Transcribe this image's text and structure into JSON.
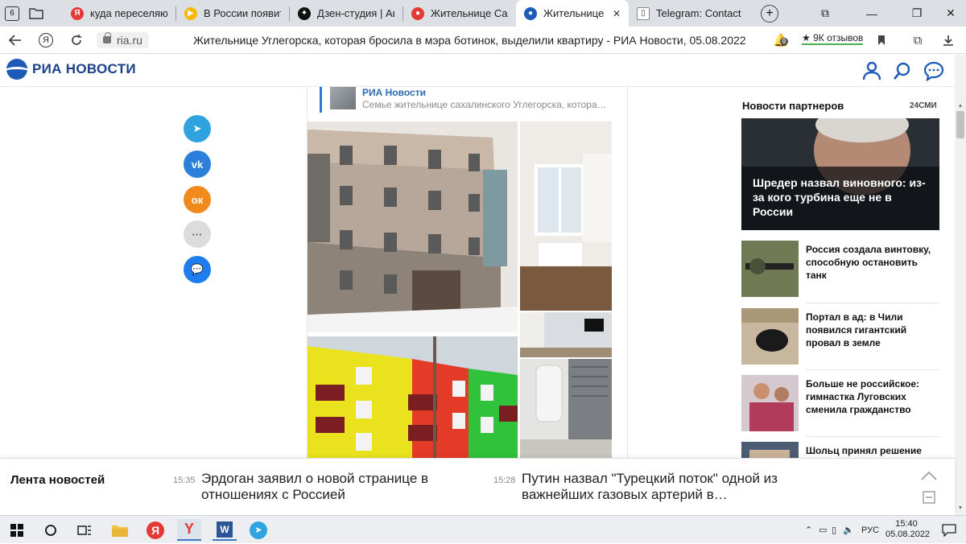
{
  "browser": {
    "tab_counter": "6",
    "tabs": [
      {
        "title": "куда переселяют и",
        "favicon": "yandex-icon",
        "color": "#e53935",
        "glyph": "Я"
      },
      {
        "title": "В России появится",
        "favicon": "play-icon",
        "color": "#f9b700",
        "glyph": "▶"
      },
      {
        "title": "Дзен-студия | Авар",
        "favicon": "zen-icon",
        "color": "#111111",
        "glyph": "✦"
      },
      {
        "title": "Жительнице Сахал",
        "favicon": "ria-icon",
        "color": "#e53935",
        "glyph": "●"
      },
      {
        "title": "Жительнице Угл",
        "favicon": "ria-icon",
        "color": "#1e5bb8",
        "glyph": "●",
        "active": true
      },
      {
        "title": "Telegram: Contact @",
        "favicon": "page-icon",
        "color": "#ffffff",
        "glyph": "▯"
      }
    ],
    "url": "ria.ru",
    "page_title": "Жительнице Углегорска, которая бросила в мэра ботинок, выделили квартиру - РИА Новости, 05.08.2022",
    "reviews_label": "9К отзывов",
    "notif_count": "9"
  },
  "site": {
    "logo_text": "РИА НОВОСТИ",
    "brand_color": "#1e5bb8"
  },
  "share_buttons": [
    {
      "name": "telegram-share-button",
      "color": "#2fa3e0",
      "glyph": "➤"
    },
    {
      "name": "vk-share-button",
      "color": "#2d7fdc",
      "glyph": "vk"
    },
    {
      "name": "ok-share-button",
      "color": "#f08a1c",
      "glyph": "ок"
    },
    {
      "name": "more-share-button",
      "color": "#dcdcdc",
      "glyph": "···"
    },
    {
      "name": "comments-share-button",
      "color": "#1e7ef0",
      "glyph": "💬"
    }
  ],
  "embed": {
    "source": "РИА Новости",
    "text": "Семье жительнице сахалинского Углегорска, котора…"
  },
  "partners": {
    "heading": "Новости партнеров",
    "brand": "24СМИ",
    "featured": "Шредер назвал виновного: из-за кого турбина еще не в России",
    "items": [
      "Россия создала винтовку, способную остановить танк",
      "Портал в ад: в Чили появился гигантский провал в земле",
      "Больше не российское: гимнастка Луговских сменила гражданство",
      "Шольц принял решение"
    ]
  },
  "ticker": {
    "label": "Лента новостей",
    "items": [
      {
        "time": "15:35",
        "text": "Эрдоган заявил о новой странице в отношениях с Россией"
      },
      {
        "time": "15:28",
        "text": "Путин назвал \"Турецкий поток\" одной из важнейших газовых артерий в…"
      }
    ]
  },
  "taskbar": {
    "lang": "РУС",
    "time": "15:40",
    "date": "05.08.2022"
  }
}
